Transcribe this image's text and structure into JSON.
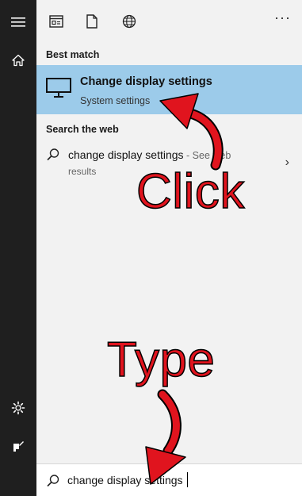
{
  "sidebar": {
    "icons": [
      "hamburger-icon",
      "home-icon",
      "settings-gear-icon",
      "feedback-person-icon"
    ]
  },
  "topbar": {
    "icons": [
      "apps-icon",
      "document-icon",
      "web-globe-icon"
    ],
    "more_label": "···"
  },
  "best_match": {
    "section_title": "Best match",
    "title": "Change display settings",
    "subtitle": "System settings",
    "icon": "monitor-icon"
  },
  "web": {
    "section_title": "Search the web",
    "query_text": "change display settings",
    "query_suffix": " - See web",
    "second_line": "results",
    "chevron": "›"
  },
  "search": {
    "value": "change display settings",
    "icon": "search-icon"
  },
  "annotations": {
    "click_label": "Click",
    "type_label": "Type",
    "color": "#e0141e"
  }
}
